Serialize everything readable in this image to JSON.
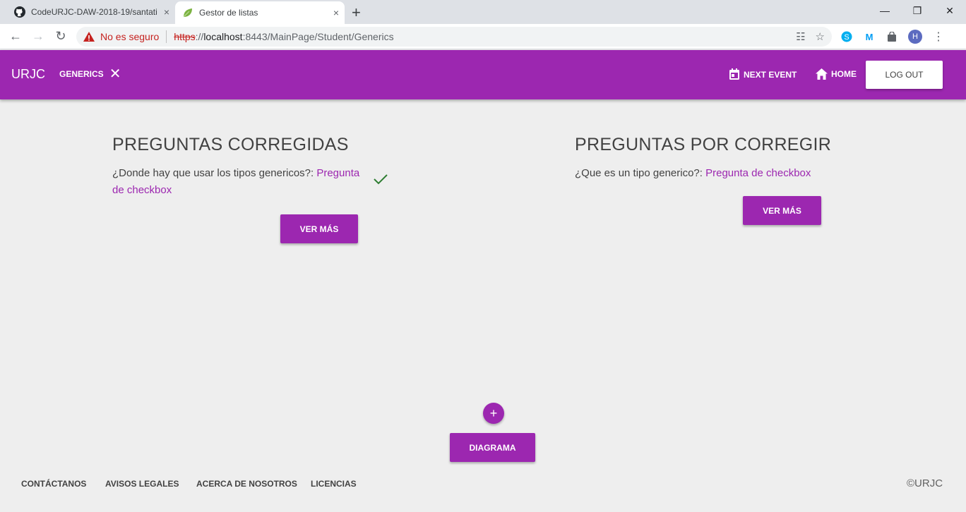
{
  "browser": {
    "tabs": [
      {
        "title": "CodeURJC-DAW-2018-19/santati",
        "icon": "github-icon"
      },
      {
        "title": "Gestor de listas",
        "icon": "leaf-icon"
      }
    ],
    "tab_close": "×",
    "new_tab": "+",
    "window_controls": {
      "minimize": "—",
      "maximize": "❐",
      "close": "✕"
    },
    "security_label": "No es seguro",
    "url": {
      "scheme": "https",
      "sep": "://",
      "host": "localhost",
      "rest": ":8443/MainPage/Student/Generics"
    },
    "profile_initial": "H"
  },
  "appbar": {
    "brand": "URJC",
    "chip_label": "GENERICS",
    "chip_close": "✕",
    "next_event": "NEXT EVENT",
    "home": "HOME",
    "logout": "LOG OUT",
    "color": "#9c27b0"
  },
  "corrected": {
    "title": "PREGUNTAS CORREGIDAS",
    "question": "¿Donde hay que usar los tipos genericos?:",
    "link": "Pregunta de checkbox",
    "status_icon": "check-icon",
    "button": "VER MÁS"
  },
  "pending": {
    "title": "PREGUNTAS POR CORREGIR",
    "question": "¿Que es un tipo generico?:",
    "link": "Pregunta de checkbox",
    "button": "VER MÁS"
  },
  "fab": "+",
  "diagram_button": "DIAGRAMA",
  "footer": {
    "links": [
      "CONTÁCTANOS",
      "AVISOS LEGALES",
      "ACERCA DE NOSOTROS",
      "LICENCIAS"
    ],
    "copyright": "©URJC"
  }
}
